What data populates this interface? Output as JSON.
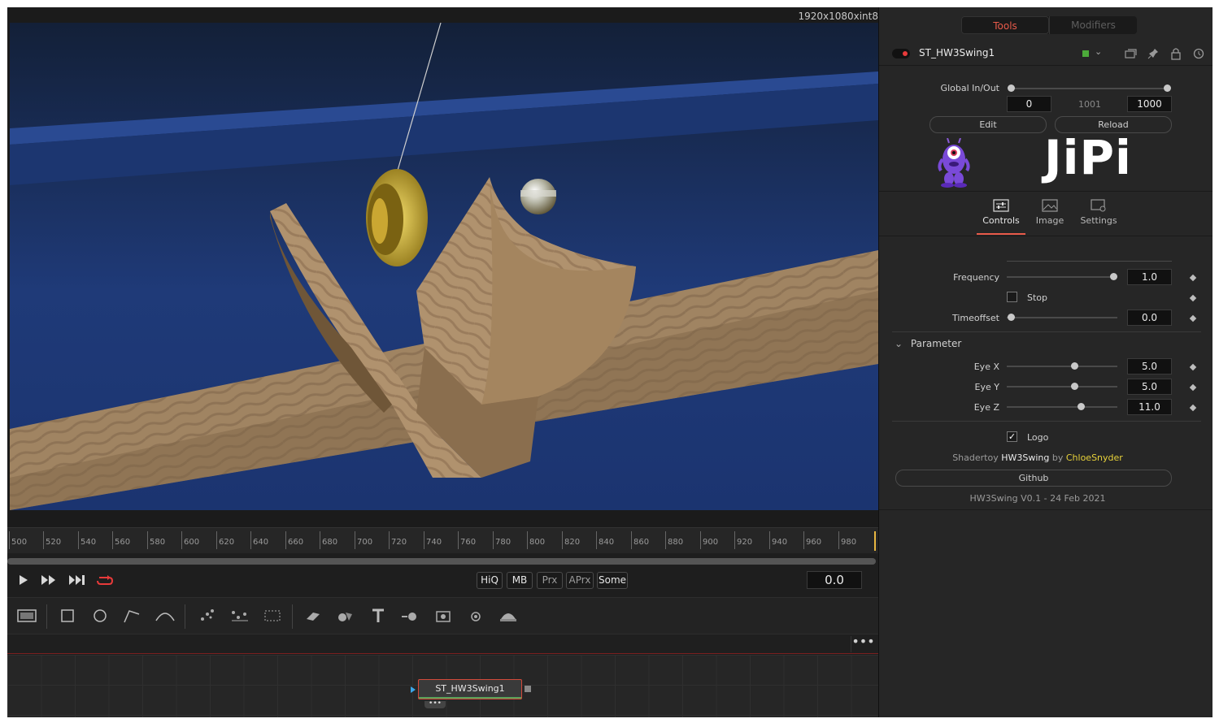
{
  "viewer": {
    "resolution": "1920x1080xint8",
    "ruler_ticks": [
      "500",
      "520",
      "540",
      "560",
      "580",
      "600",
      "620",
      "640",
      "660",
      "680",
      "700",
      "720",
      "740",
      "760",
      "780",
      "800",
      "820",
      "840",
      "860",
      "880",
      "900",
      "920",
      "940",
      "960",
      "980"
    ]
  },
  "transport": {
    "play_icon": "play-icon",
    "fast_forward_icon": "fast-forward-icon",
    "skip_end_icon": "skip-to-end-icon",
    "loop_icon": "loop-icon",
    "quality_buttons": [
      "HiQ",
      "MB",
      "Prx",
      "APrx",
      "Some"
    ],
    "current_time": "0.0"
  },
  "toolbar": {
    "tools": [
      "background-tool-icon",
      "rectangle-mask-icon",
      "ellipse-mask-icon",
      "polygon-mask-icon",
      "bspline-mask-icon",
      "particle-emitter-icon",
      "particle-render-icon",
      "particle-style-icon",
      "shape3d-icon",
      "merge3d-icon",
      "text3d-icon",
      "renderer3d-icon",
      "camera3d-icon",
      "spotlight-icon",
      "image-plane-icon"
    ]
  },
  "flow": {
    "node_name": "ST_HW3Swing1",
    "more_label": "•••"
  },
  "inspector": {
    "tabs": [
      "Tools",
      "Modifiers"
    ],
    "tool_name": "ST_HW3Swing1",
    "global_in_out_label": "Global In/Out",
    "global_in": "0",
    "global_mid": "1001",
    "global_out": "1000",
    "edit_label": "Edit",
    "reload_label": "Reload",
    "logo_text": "JiPi",
    "page_tabs": [
      "Controls",
      "Image",
      "Settings"
    ],
    "frequency_label": "Frequency",
    "frequency_value": "1.0",
    "stop_label": "Stop",
    "timeoffset_label": "Timeoffset",
    "timeoffset_value": "0.0",
    "parameter_group": "Parameter",
    "eye_x_label": "Eye X",
    "eye_x_value": "5.0",
    "eye_y_label": "Eye Y",
    "eye_y_value": "5.0",
    "eye_z_label": "Eye Z",
    "eye_z_value": "11.0",
    "logo_checkbox_label": "Logo",
    "logo_checked": true,
    "credit_prefix": "Shadertoy",
    "credit_title": "HW3Swing",
    "credit_by": "by",
    "credit_author": "ChloeSnyder",
    "github_label": "Github",
    "version_text": "HW3Swing V0.1 - 24 Feb 2021"
  },
  "colors": {
    "accent": "#e85a4a",
    "author": "#e8d23a",
    "tool_swatch": "#4caa3a"
  }
}
